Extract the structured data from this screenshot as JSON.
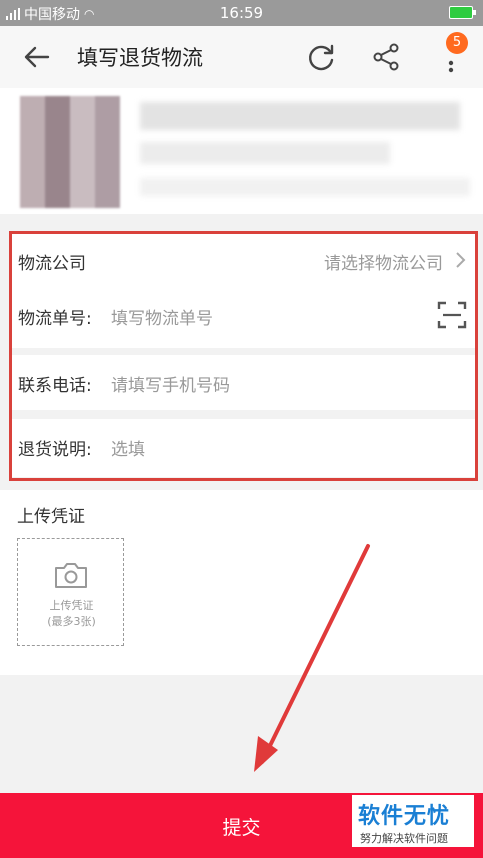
{
  "status_bar": {
    "carrier": "中国移动",
    "time": "16:59"
  },
  "header": {
    "title": "填写退货物流",
    "badge_count": "5",
    "icons": [
      "back-icon",
      "refresh-icon",
      "share-icon",
      "more-icon"
    ]
  },
  "form": {
    "company_label": "物流公司",
    "company_hint": "请选择物流公司",
    "tracking_label": "物流单号:",
    "tracking_placeholder": "填写物流单号",
    "phone_label": "联系电话:",
    "phone_placeholder": "请填写手机号码",
    "note_label": "退货说明:",
    "note_placeholder": "选填"
  },
  "upload": {
    "title": "上传凭证",
    "box_line1": "上传凭证",
    "box_line2": "(最多3张)"
  },
  "submit_label": "提交",
  "watermark": {
    "title": "软件无忧",
    "subtitle": "努力解决软件问题"
  },
  "colors": {
    "accent": "#f5143a",
    "highlight": "#d9413b",
    "badge": "#ff6a1f",
    "watermark": "#1a7fd4"
  }
}
